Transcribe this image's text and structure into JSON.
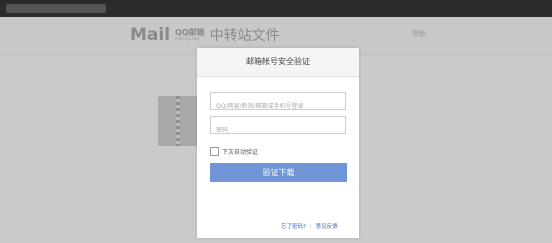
{
  "header": {
    "logo_mail": "Mail",
    "logo_qq": "QQ邮箱",
    "logo_qq_sub": "mail.qq.com",
    "service": "中转站文件",
    "help": "帮助"
  },
  "dialog": {
    "title": "邮箱帐号安全验证",
    "account_placeholder": "QQ/网易/新浪/邮箱或手机号登录",
    "password_placeholder": "密码",
    "remember_label": "下次自动验证",
    "verify_button": "验证下载",
    "forgot_link": "忘了密码?",
    "separator": "|",
    "feedback_link": "意见反馈"
  },
  "colors": {
    "primary_button": "#6f95d6",
    "link": "#3a66b8"
  },
  "icons": {
    "file_icon": "zip-file-icon",
    "checkbox": "checkbox-unchecked-icon"
  }
}
